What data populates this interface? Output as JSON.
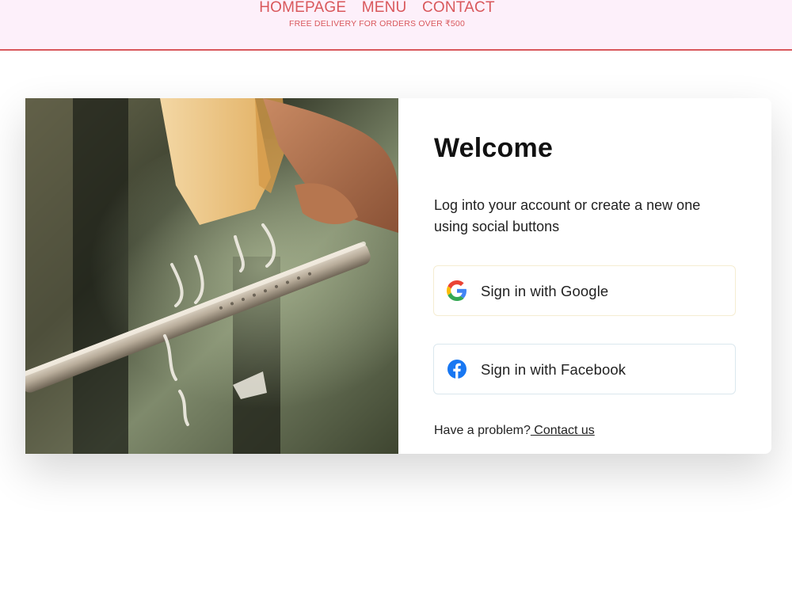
{
  "nav": {
    "items": [
      {
        "label": "HOMEPAGE"
      },
      {
        "label": "MENU"
      },
      {
        "label": "CONTACT"
      }
    ],
    "promo": "FREE DELIVERY FOR ORDERS OVER ₹500"
  },
  "login": {
    "title": "Welcome",
    "subtitle": "Log into your account or create a new one using social buttons",
    "google_label": "Sign in with Google",
    "facebook_label": "Sign in with Facebook",
    "help_text": "Have a problem?",
    "help_link": " Contact us"
  },
  "icons": {
    "google": "google-logo-icon",
    "facebook": "facebook-logo-icon"
  },
  "colors": {
    "accent": "#d9585c",
    "header_bg": "#fdf0fa",
    "facebook_blue": "#1877f2"
  }
}
